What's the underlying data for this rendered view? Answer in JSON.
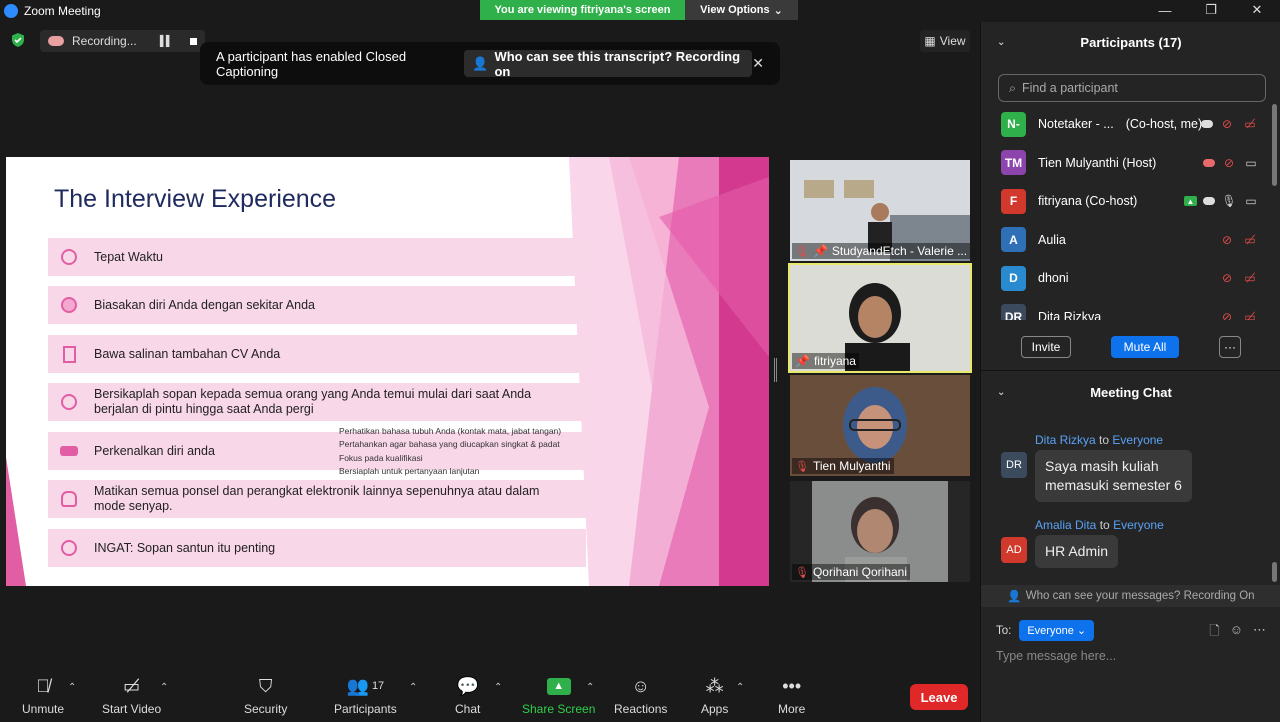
{
  "window": {
    "title": "Zoom Meeting",
    "viewing_banner": "You are viewing fitriyana's screen",
    "view_options": "View Options"
  },
  "recording": {
    "label": "Recording..."
  },
  "view_button": "View",
  "caption_toast": {
    "message": "A participant has enabled Closed Captioning",
    "action": "Who can see this transcript? Recording on"
  },
  "slide": {
    "title": "The Interview Experience",
    "items": [
      "Tepat Waktu",
      "Biasakan diri Anda dengan sekitar Anda",
      "Bawa salinan tambahan CV Anda",
      "Bersikaplah sopan kepada semua orang yang Anda temui mulai dari saat Anda berjalan di pintu hingga saat Anda pergi",
      "Perkenalkan diri anda",
      "Matikan semua ponsel dan perangkat elektronik lainnya sepenuhnya atau dalam mode senyap.",
      "INGAT: Sopan santun itu penting"
    ],
    "sub_notes": [
      "Perhatikan bahasa tubuh Anda (kontak mata, jabat tangan)",
      "Pertahankan agar bahasa yang diucapkan singkat & padat",
      "Fokus pada kualifikasi",
      "Bersiaplah untuk pertanyaan lanjutan"
    ]
  },
  "video_tiles": [
    {
      "name": "StudyandEtch - Valerie ..."
    },
    {
      "name": "fitriyana"
    },
    {
      "name": "Tien Mulyanthi"
    },
    {
      "name": "Qorihani Qorihani"
    }
  ],
  "participants": {
    "header": "Participants (17)",
    "search_placeholder": "Find a participant",
    "list": [
      {
        "initials": "N-",
        "name": "Notetaker - ...",
        "role": "(Co-host, me)",
        "color": "#2fb04a"
      },
      {
        "initials": "TM",
        "name": "Tien Mulyanthi (Host)",
        "role": "",
        "color": "#8e44ad"
      },
      {
        "initials": "F",
        "name": "fitriyana (Co-host)",
        "role": "",
        "color": "#d0392b"
      },
      {
        "initials": "A",
        "name": "Aulia",
        "role": "",
        "color": "#2e6fb5"
      },
      {
        "initials": "D",
        "name": "dhoni",
        "role": "",
        "color": "#2a8ad0"
      },
      {
        "initials": "DR",
        "name": "Dita Rizkva",
        "role": "",
        "color": "#3b4a5c"
      }
    ],
    "invite": "Invite",
    "mute_all": "Mute All",
    "more": "···"
  },
  "chat": {
    "header": "Meeting Chat",
    "messages": [
      {
        "sender": "Dita Rizkya",
        "to_word": "to",
        "recipient": "Everyone",
        "initials": "DR",
        "text_line1": "Saya masih kuliah",
        "text_line2": "memasuki semester 6"
      },
      {
        "sender": "Amalia Dita",
        "to_word": "to",
        "recipient": "Everyone",
        "initials": "AD",
        "text": "HR Admin"
      }
    ],
    "notice": "Who can see your messages? Recording On",
    "to_label": "To:",
    "to_value": "Everyone",
    "input_placeholder": "Type message here..."
  },
  "toolbar": {
    "unmute": "Unmute",
    "start_video": "Start Video",
    "security": "Security",
    "participants": "Participants",
    "participants_count": "17",
    "chat": "Chat",
    "share_screen": "Share Screen",
    "reactions": "Reactions",
    "apps": "Apps",
    "more": "More",
    "leave": "Leave"
  },
  "colors": {
    "accent_blue": "#0e72ed",
    "green": "#2fb04a",
    "leave_red": "#e02828",
    "slide_pink": "#f8d7e9",
    "slide_title": "#1f2a5e"
  }
}
